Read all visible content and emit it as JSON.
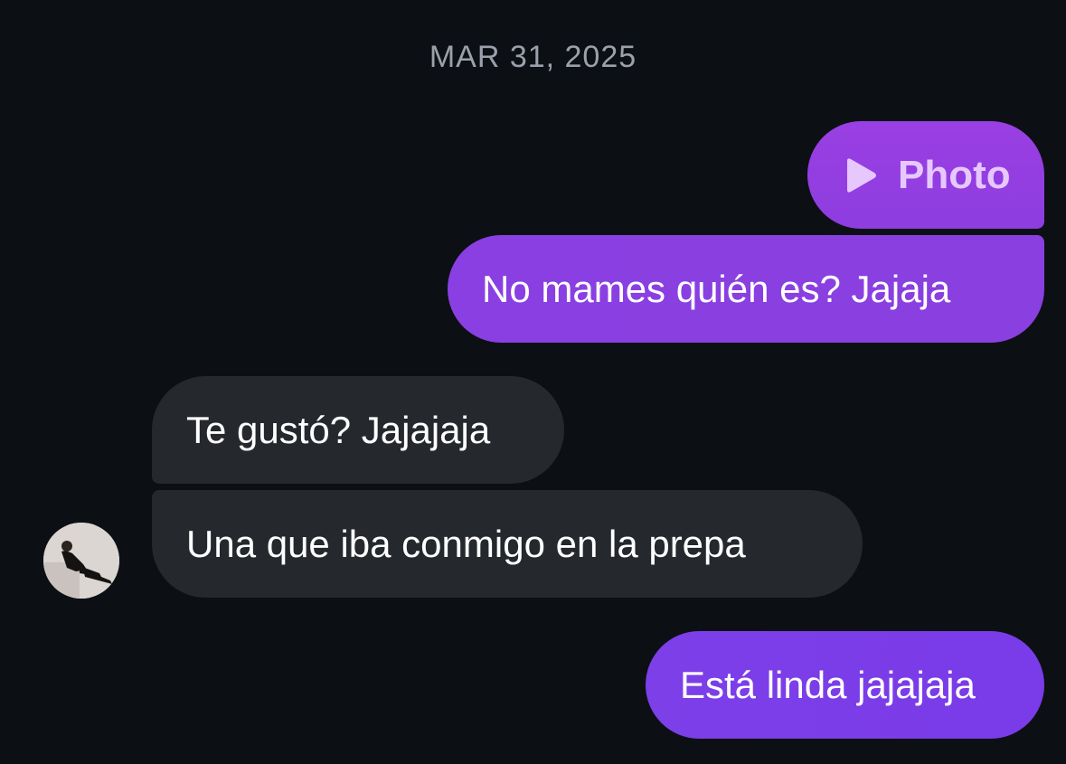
{
  "conversation": {
    "date_label": "MAR 31, 2025",
    "messages": [
      {
        "direction": "outgoing",
        "type": "photo",
        "label": "Photo",
        "icon": "play-icon"
      },
      {
        "direction": "outgoing",
        "type": "text",
        "text": "No mames quién es? Jajaja"
      },
      {
        "direction": "incoming",
        "type": "text",
        "text": "Te gustó? Jajajaja"
      },
      {
        "direction": "incoming",
        "type": "text",
        "text": "Una que iba conmigo en la prepa"
      },
      {
        "direction": "outgoing",
        "type": "text",
        "text": "Está linda jajajaja"
      }
    ]
  },
  "colors": {
    "background": "#0c0f14",
    "outgoing_bubble": "#8a3fe0",
    "incoming_bubble": "#25282d",
    "date_text": "#9ba1ab"
  }
}
